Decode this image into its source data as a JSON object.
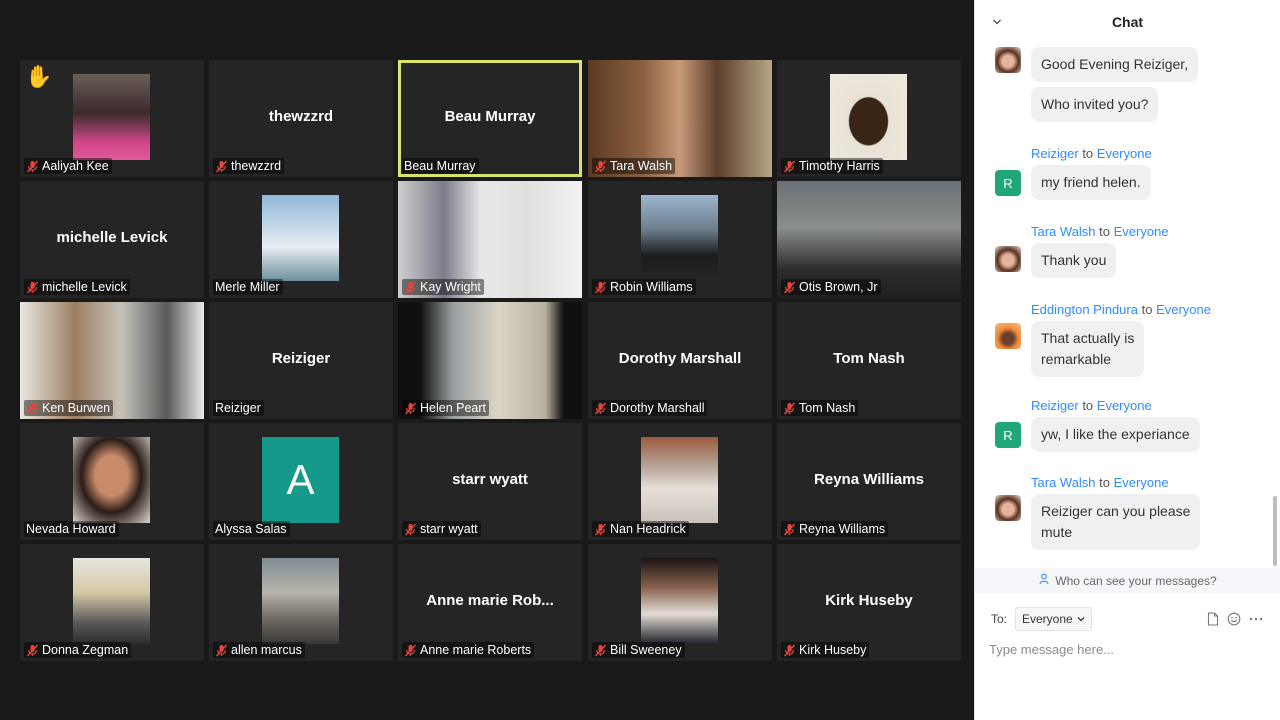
{
  "gallery": {
    "tiles": [
      {
        "name": "Aaliyah Kee",
        "center": "",
        "muted": true,
        "photo": "square",
        "hand": true
      },
      {
        "name": "thewzzrd",
        "center": "thewzzrd",
        "muted": true,
        "photo": "none"
      },
      {
        "name": "Beau Murray",
        "center": "Beau Murray",
        "muted": false,
        "photo": "none",
        "active": true
      },
      {
        "name": "Tara Walsh",
        "center": "",
        "muted": true,
        "photo": "full"
      },
      {
        "name": "Timothy Harris",
        "center": "",
        "muted": true,
        "photo": "square"
      },
      {
        "name": "michelle Levick",
        "center": "michelle Levick",
        "muted": true,
        "photo": "none"
      },
      {
        "name": "Merle Miller",
        "center": "",
        "muted": false,
        "photo": "square"
      },
      {
        "name": "Kay Wright",
        "center": "",
        "muted": true,
        "photo": "full"
      },
      {
        "name": "Robin Williams",
        "center": "",
        "muted": true,
        "photo": "square"
      },
      {
        "name": "Otis Brown, Jr",
        "center": "",
        "muted": true,
        "photo": "full"
      },
      {
        "name": "Ken Burwen",
        "center": "",
        "muted": true,
        "photo": "full"
      },
      {
        "name": "Reiziger",
        "center": "Reiziger",
        "muted": false,
        "photo": "none"
      },
      {
        "name": "Helen Peart",
        "center": "",
        "muted": true,
        "photo": "full"
      },
      {
        "name": "Dorothy Marshall",
        "center": "Dorothy Marshall",
        "muted": true,
        "photo": "none"
      },
      {
        "name": "Tom Nash",
        "center": "Tom Nash",
        "muted": true,
        "photo": "none"
      },
      {
        "name": "Nevada Howard",
        "center": "",
        "muted": false,
        "photo": "square"
      },
      {
        "name": "Alyssa Salas",
        "center": "",
        "muted": false,
        "photo": "letter",
        "letter": "A"
      },
      {
        "name": "starr wyatt",
        "center": "starr wyatt",
        "muted": true,
        "photo": "none"
      },
      {
        "name": "Nan Headrick",
        "center": "",
        "muted": true,
        "photo": "square"
      },
      {
        "name": "Reyna Williams",
        "center": "Reyna Williams",
        "muted": true,
        "photo": "none"
      },
      {
        "name": "Donna Zegman",
        "center": "",
        "muted": true,
        "photo": "square"
      },
      {
        "name": "allen marcus",
        "center": "",
        "muted": true,
        "photo": "square"
      },
      {
        "name": "Anne marie Roberts",
        "center": "Anne marie Rob...",
        "muted": true,
        "photo": "none"
      },
      {
        "name": "Bill Sweeney",
        "center": "",
        "muted": true,
        "photo": "square"
      },
      {
        "name": "Kirk Huseby",
        "center": "Kirk Huseby",
        "muted": true,
        "photo": "none"
      }
    ]
  },
  "chat": {
    "title": "Chat",
    "to_word": "to",
    "messages": [
      {
        "sender": "",
        "recipient": "",
        "avatar": "photo-tara",
        "lines": [
          "Good Evening Reiziger,"
        ]
      },
      {
        "sender": "",
        "recipient": "",
        "avatar": "",
        "lines": [
          "Who invited you?"
        ]
      },
      {
        "sender": "Reiziger",
        "recipient": "Everyone",
        "avatar": "R",
        "lines": [
          "my friend helen."
        ]
      },
      {
        "sender": "Tara Walsh",
        "recipient": "Everyone",
        "avatar": "photo-tara",
        "lines": [
          "Thank you"
        ]
      },
      {
        "sender": "Eddington Pindura",
        "recipient": "Everyone",
        "avatar": "photo-eddington",
        "lines": [
          "That actually is",
          "remarkable"
        ]
      },
      {
        "sender": "Reiziger",
        "recipient": "Everyone",
        "avatar": "R",
        "lines": [
          "yw, I like the experiance"
        ]
      },
      {
        "sender": "Tara Walsh",
        "recipient": "Everyone",
        "avatar": "photo-tara",
        "lines": [
          "Reiziger can you please",
          "mute"
        ]
      }
    ],
    "privacy_text": "Who can see your messages?",
    "to_label": "To:",
    "recipient": "Everyone",
    "placeholder": "Type message here...",
    "colors": {
      "link": "#2d8cff",
      "active_border": "#d8e46c",
      "avatar_green": "#21a67a",
      "tile_avatar": "#14998a"
    }
  }
}
